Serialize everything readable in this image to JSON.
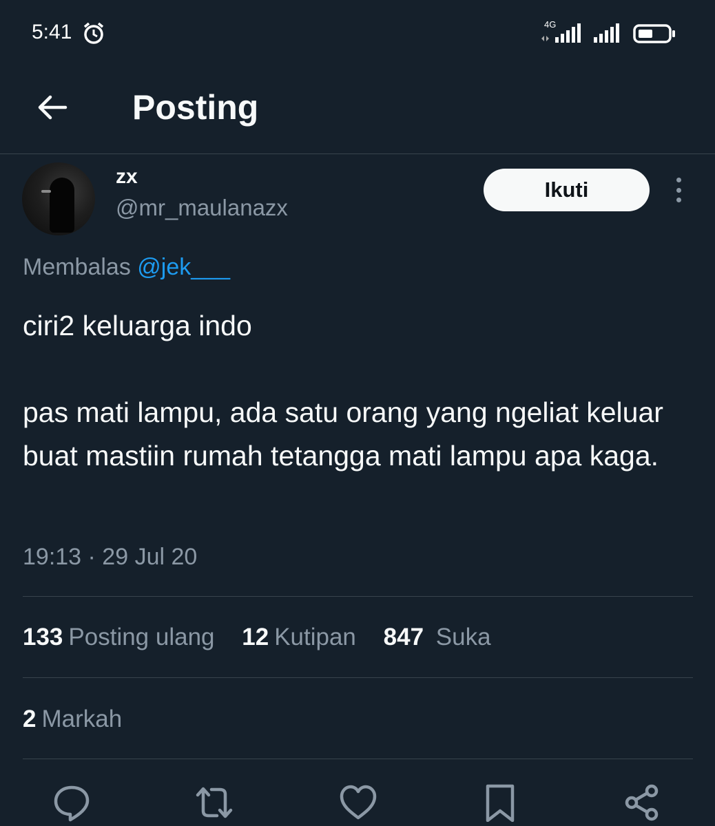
{
  "status_bar": {
    "time": "5:41",
    "network": "4G",
    "icons": [
      "alarm-icon",
      "signal-icon",
      "signal-icon",
      "battery-icon"
    ]
  },
  "header": {
    "title": "Posting",
    "back_icon": "arrow-left-icon"
  },
  "post": {
    "author_name": "zx",
    "author_handle": "@mr_maulanazx",
    "follow_label": "Ikuti",
    "reply_prefix": "Membalas",
    "reply_to": "@jek___",
    "text": "ciri2 keluarga indo\n\npas mati lampu, ada satu orang yang ngeliat keluar buat mastiin rumah tetangga mati lampu apa kaga.",
    "timestamp": "19:13 · 29 Jul 20"
  },
  "stats": {
    "reposts_count": "133",
    "reposts_label": "Posting ulang",
    "quotes_count": "12",
    "quotes_label": "Kutipan",
    "likes_count": "847",
    "likes_label": "Suka",
    "bookmarks_count": "2",
    "bookmarks_label": "Markah"
  },
  "actions": [
    "reply-icon",
    "repost-icon",
    "like-icon",
    "bookmark-icon",
    "share-icon"
  ],
  "colors": {
    "background": "#15202b",
    "text_primary": "#f7f9f9",
    "text_secondary": "#8b98a5",
    "accent": "#1d9bf0",
    "divider": "#38444d"
  }
}
